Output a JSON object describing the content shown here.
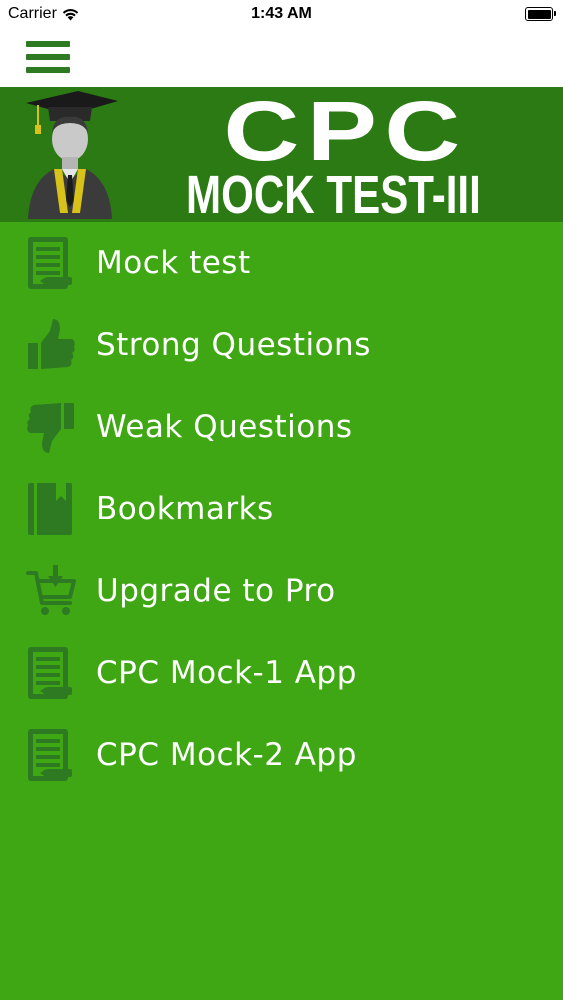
{
  "status_bar": {
    "carrier": "Carrier",
    "time": "1:43 AM"
  },
  "nav": {
    "menu_icon": "hamburger-menu-icon"
  },
  "banner": {
    "title": "CPC",
    "subtitle": "MOCK TEST-III",
    "avatar_icon": "graduate-avatar-icon"
  },
  "menu": {
    "items": [
      {
        "label": "Mock test",
        "icon": "notebook-icon"
      },
      {
        "label": "Strong Questions",
        "icon": "thumbs-up-icon"
      },
      {
        "label": "Weak Questions",
        "icon": "thumbs-down-icon"
      },
      {
        "label": "Bookmarks",
        "icon": "bookmark-book-icon"
      },
      {
        "label": "Upgrade to Pro",
        "icon": "cart-download-icon"
      },
      {
        "label": "CPC Mock-1 App",
        "icon": "notebook-icon"
      },
      {
        "label": "CPC Mock-2 App",
        "icon": "notebook-icon"
      }
    ]
  },
  "colors": {
    "background": "#3fa614",
    "banner": "#2b7a14",
    "icon": "#2d7a22",
    "text": "#ffffff"
  }
}
